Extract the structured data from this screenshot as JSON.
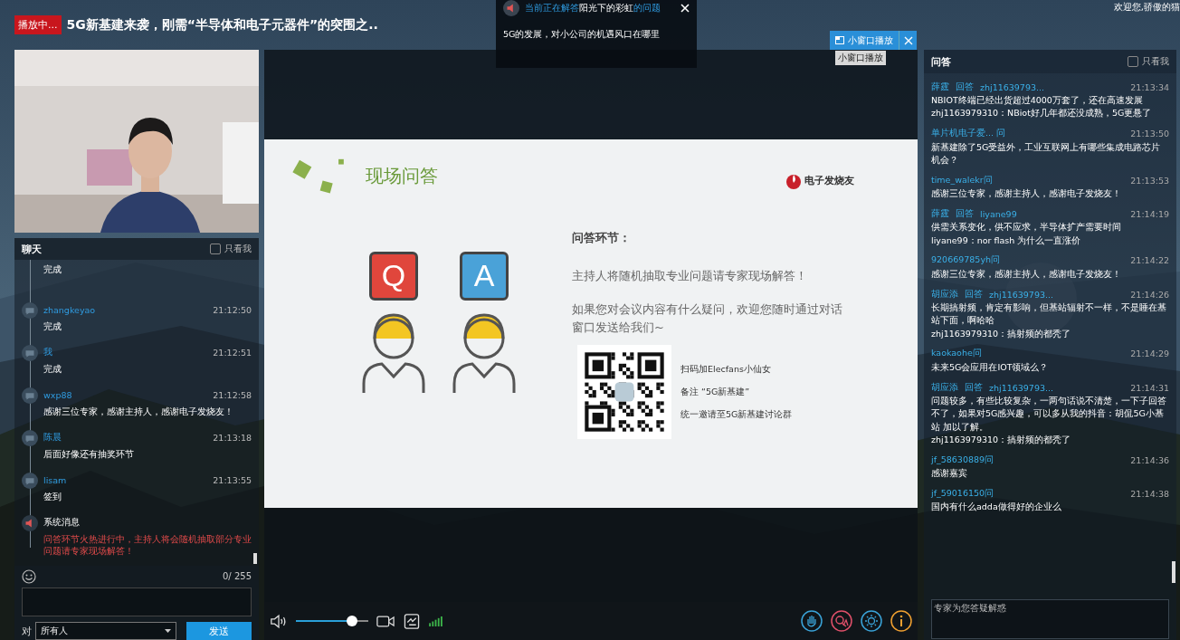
{
  "header": {
    "badge": "播放中...",
    "title": "5G新基建来袭，刚需“半导体和电子元器件”的突围之..",
    "welcome": "欢迎您,骄傲的猫"
  },
  "notice": {
    "prefix": "当前正在解答",
    "user": "阳光下的彩虹",
    "suffix": "的问题",
    "question": "5G的发展，对小公司的机遇风口在哪里"
  },
  "mini_window": {
    "label": "小窗口播放",
    "tooltip": "小窗口播放"
  },
  "chat": {
    "title": "聊天",
    "only_me": {
      "label": "只看我",
      "checked": false
    },
    "messages": [
      {
        "kind": "user",
        "text": "完成"
      },
      {
        "kind": "user",
        "name": "zhangkeyao",
        "time": "21:12:50",
        "text": "完成"
      },
      {
        "kind": "user",
        "name": "我",
        "time": "21:12:51",
        "text": "完成"
      },
      {
        "kind": "user",
        "name": "wxp88",
        "time": "21:12:58",
        "text": "感谢三位专家，感谢主持人，感谢电子发烧友！"
      },
      {
        "kind": "user",
        "name": "陈晨",
        "time": "21:13:18",
        "text": "后面好像还有抽奖环节"
      },
      {
        "kind": "user",
        "name": "lisam",
        "time": "21:13:55",
        "text": "签到"
      },
      {
        "kind": "system",
        "name": "系统消息",
        "text": "问答环节火热进行中，主持人将会随机抽取部分专业问题请专家现场解答！"
      }
    ],
    "counter": "0/ 255",
    "to_label": "对",
    "recipient": "所有人",
    "send": "发送"
  },
  "slide": {
    "title": "现场问答",
    "logo": "电子发烧友",
    "q": "Q",
    "a": "A",
    "heading": "问答环节：",
    "line1": "主持人将随机抽取专业问题请专家现场解答！",
    "line2": "如果您对会议内容有什么疑问，欢迎您随时通过对话窗口发送给我们~",
    "qr_lines": [
      "扫码加Elecfans小仙女",
      "备注 “5G新基建”",
      "统一邀请至5G新基建讨论群"
    ]
  },
  "player": {
    "volume": {
      "level": 0.78
    }
  },
  "qa": {
    "title": "问答",
    "only_me": {
      "label": "只看我",
      "checked": false
    },
    "items": [
      {
        "heads": [
          "薛霆",
          "回答",
          "zhj11639793..."
        ],
        "time": "21:13:34",
        "lines": [
          "NBIOT终端已经出货超过4000万套了，还在高速发展",
          "zhj1163979310：NBiot好几年都还没成熟，5G更悬了"
        ]
      },
      {
        "heads": [
          "单片机电子爱... 问"
        ],
        "time": "21:13:50",
        "lines": [
          "新基建除了5G受益外，工业互联网上有哪些集成电路芯片机会？"
        ]
      },
      {
        "heads": [
          "time_walekr问"
        ],
        "time": "21:13:53",
        "lines": [
          "感谢三位专家，感谢主持人，感谢电子发烧友！"
        ]
      },
      {
        "heads": [
          "薛霆",
          "回答",
          "liyane99"
        ],
        "time": "21:14:19",
        "lines": [
          "供需关系变化，供不应求，半导体扩产需要时间",
          "liyane99：nor flash 为什么一直涨价"
        ]
      },
      {
        "heads": [
          "920669785yh问"
        ],
        "time": "21:14:22",
        "lines": [
          "感谢三位专家，感谢主持人，感谢电子发烧友！"
        ]
      },
      {
        "heads": [
          "胡应添",
          "回答",
          "zhj11639793..."
        ],
        "time": "21:14:26",
        "lines": [
          "长期搞射频，肯定有影响，但基站辐射不一样，不是睡在基站下面，啊哈哈",
          "zhj1163979310：搞射频的都秃了"
        ]
      },
      {
        "heads": [
          "kaokaohe问"
        ],
        "time": "21:14:29",
        "lines": [
          "未来5G会应用在IOT领域么？"
        ]
      },
      {
        "heads": [
          "胡应添",
          "回答",
          "zhj11639793..."
        ],
        "time": "21:14:31",
        "lines": [
          "问题较多，有些比较复杂，一两句话说不清楚，一下子回答不了，如果对5G感兴趣，可以多从我的抖音：胡侃5G小基站 加以了解。",
          "zhj1163979310：搞射频的都秃了"
        ]
      },
      {
        "heads": [
          "jf_58630889问"
        ],
        "time": "21:14:36",
        "lines": [
          "感谢嘉宾"
        ]
      },
      {
        "heads": [
          "jf_59016150问"
        ],
        "time": "21:14:38",
        "lines": [
          "国内有什么adda做得好的企业么"
        ]
      }
    ],
    "input_placeholder": "专家为您答疑解惑"
  }
}
